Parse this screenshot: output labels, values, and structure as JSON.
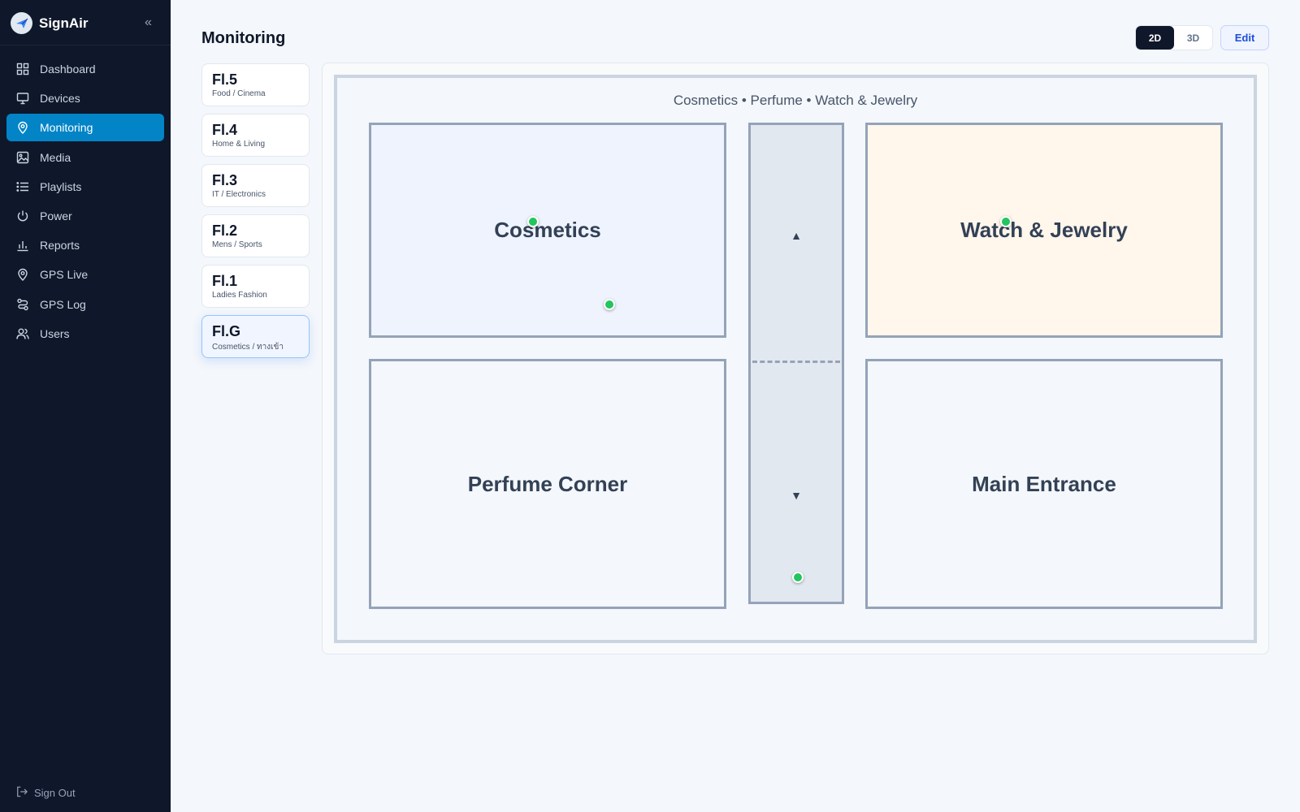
{
  "app": {
    "name": "SignAir",
    "collapse_icon": "«"
  },
  "sidebar": {
    "items": [
      {
        "label": "Dashboard",
        "icon": "grid-icon"
      },
      {
        "label": "Devices",
        "icon": "monitor-icon"
      },
      {
        "label": "Monitoring",
        "icon": "map-pin-icon",
        "active": true
      },
      {
        "label": "Media",
        "icon": "image-icon"
      },
      {
        "label": "Playlists",
        "icon": "list-icon"
      },
      {
        "label": "Power",
        "icon": "power-icon"
      },
      {
        "label": "Reports",
        "icon": "bar-chart-icon"
      },
      {
        "label": "GPS Live",
        "icon": "map-pin-icon"
      },
      {
        "label": "GPS Log",
        "icon": "route-icon"
      },
      {
        "label": "Users",
        "icon": "users-icon"
      }
    ],
    "signout": "Sign Out"
  },
  "header": {
    "title": "Monitoring",
    "view_2d": "2D",
    "view_3d": "3D",
    "active_view": "2D",
    "edit": "Edit"
  },
  "floors": [
    {
      "name": "Fl.5",
      "sub": "Food / Cinema"
    },
    {
      "name": "Fl.4",
      "sub": "Home & Living"
    },
    {
      "name": "Fl.3",
      "sub": "IT / Electronics"
    },
    {
      "name": "Fl.2",
      "sub": "Mens / Sports"
    },
    {
      "name": "Fl.1",
      "sub": "Ladies Fashion"
    },
    {
      "name": "Fl.G",
      "sub": "Cosmetics / ทางเข้า",
      "active": true
    }
  ],
  "map": {
    "header": "Cosmetics • Perfume • Watch & Jewelry",
    "zones": {
      "cosmetics": "Cosmetics",
      "watch": "Watch & Jewelry",
      "perfume": "Perfume Corner",
      "entrance": "Main Entrance"
    },
    "arrow_up": "▲",
    "arrow_down": "▼",
    "sensor_status": "online"
  },
  "colors": {
    "sidebar_bg": "#0f172a",
    "accent": "#0284c7",
    "sensor_online": "#22c55e",
    "zone_cosmetics": "#eef3fe",
    "zone_watch": "#fff6ec"
  }
}
